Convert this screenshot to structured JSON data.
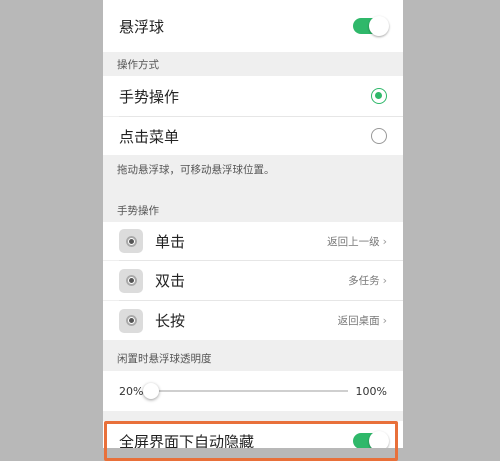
{
  "floating_ball": {
    "label": "悬浮球",
    "enabled": true
  },
  "operation_mode": {
    "header": "操作方式",
    "options": [
      {
        "label": "手势操作",
        "selected": true
      },
      {
        "label": "点击菜单",
        "selected": false
      }
    ],
    "hint": "拖动悬浮球，可移动悬浮球位置。"
  },
  "gesture": {
    "header": "手势操作",
    "items": [
      {
        "label": "单击",
        "value": "返回上一级"
      },
      {
        "label": "双击",
        "value": "多任务"
      },
      {
        "label": "长按",
        "value": "返回桌面"
      }
    ]
  },
  "transparency": {
    "header": "闲置时悬浮球透明度",
    "min_label": "20%",
    "max_label": "100%",
    "level": 0.0
  },
  "auto_hide": {
    "label": "全屏界面下自动隐藏",
    "enabled": true
  },
  "colors": {
    "accent": "#2fb86a",
    "highlight": "#e8703a"
  },
  "icons": {
    "chevron": "›"
  }
}
